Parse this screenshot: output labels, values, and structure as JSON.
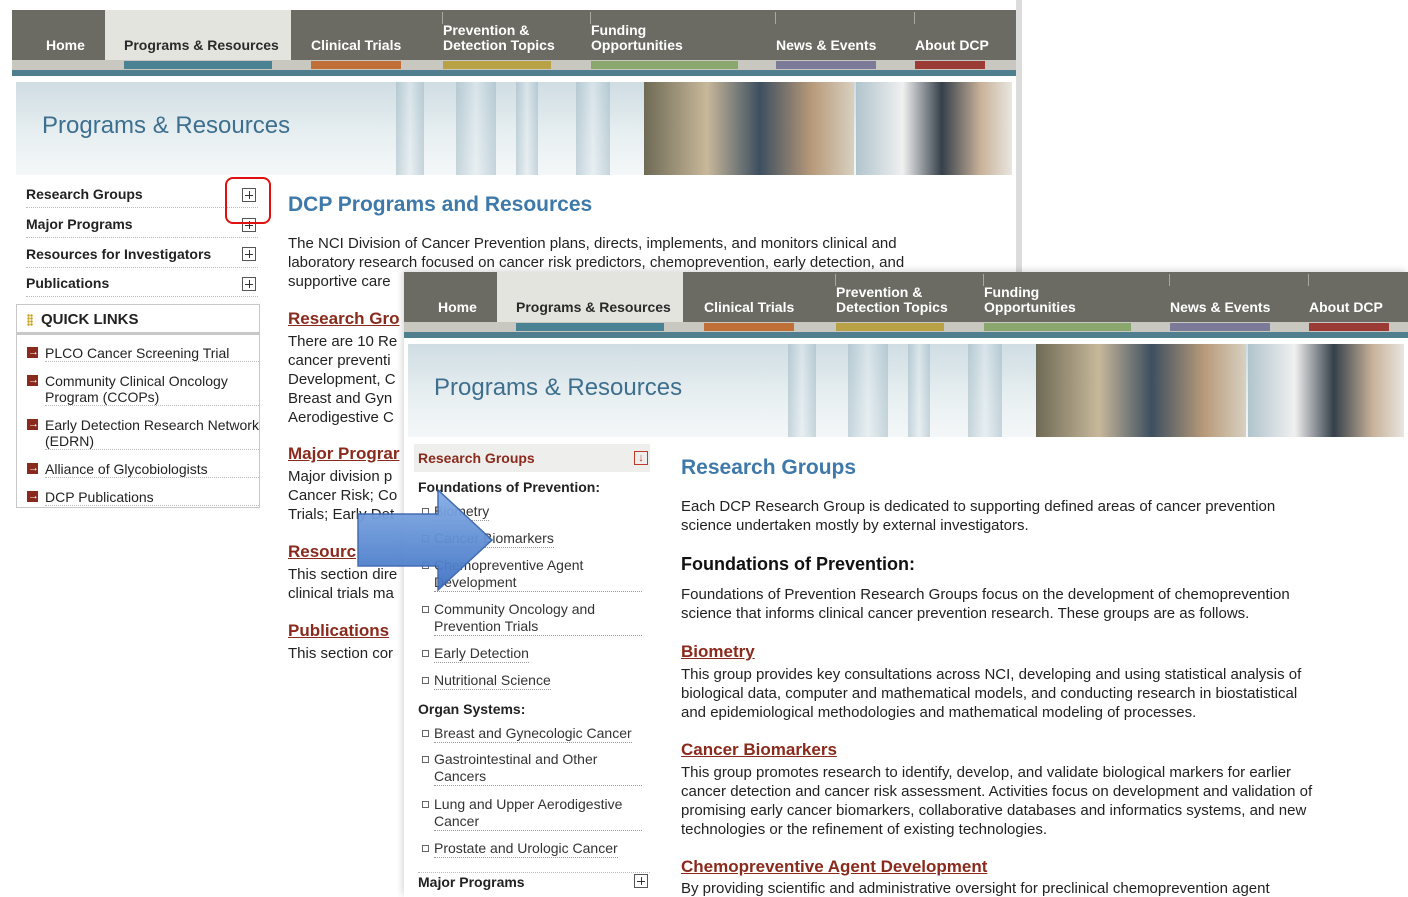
{
  "nav": {
    "items": [
      {
        "label": "Home",
        "color": "#c8c8c0"
      },
      {
        "label": "Programs & Resources",
        "color": "#4a8193"
      },
      {
        "label": "Clinical Trials",
        "color": "#c07037"
      },
      {
        "label": "Prevention & Detection Topics",
        "color": "#b9a246"
      },
      {
        "label": "Funding Opportunities",
        "color": "#8aa86e"
      },
      {
        "label": "News & Events",
        "color": "#7c7a99"
      },
      {
        "label": "About DCP",
        "color": "#9b3b35"
      }
    ],
    "active": "Programs & Resources",
    "prevention_line1": "Prevention &",
    "prevention_line2": "Detection Topics",
    "funding_line1": "Funding",
    "funding_line2": "Opportunities"
  },
  "banner": {
    "title": "Programs & Resources"
  },
  "window1": {
    "sidebar": [
      {
        "label": "Research Groups"
      },
      {
        "label": "Major Programs"
      },
      {
        "label": "Resources for Investigators"
      },
      {
        "label": "Publications"
      }
    ],
    "quick_links": {
      "title": "QUICK LINKS",
      "items": [
        {
          "label": "PLCO Cancer Screening Trial"
        },
        {
          "label": "Community Clinical Oncology Program (CCOPs)"
        },
        {
          "label": "Early Detection Research Network (EDRN)"
        },
        {
          "label": "Alliance of Glycobiologists"
        },
        {
          "label": "DCP Publications"
        }
      ]
    },
    "main": {
      "title": "DCP Programs and Resources",
      "intro_l1": "The NCI Division of Cancer Prevention plans, directs, implements, and monitors clinical and",
      "intro_l2": "laboratory research focused on cancer risk predictors, chemoprevention, early detection, and",
      "intro_l3": "supportive care",
      "rg_link": "Research Gro",
      "rg_l1": "There are 10 Re",
      "rg_l2": "cancer preventi",
      "rg_l3": "Development, C",
      "rg_l4": "Breast and Gyn",
      "rg_l5": "Aerodigestive C",
      "mp_link": "Major Prograr",
      "mp_l1": "Major division p",
      "mp_l2": "Cancer Risk; Co",
      "mp_l3": "Trials; Early Det",
      "res_link": "Resourc",
      "res_l1": "This section dire",
      "res_l2": "clinical trials ma",
      "pub_link": "Publications",
      "pub_l1": "This section cor"
    }
  },
  "window2": {
    "sidebar": {
      "research_groups": "Research Groups",
      "foundations_heading": "Foundations of Prevention:",
      "foundations_items": [
        {
          "label": "Biometry"
        },
        {
          "label": "Cancer Biomarkers"
        },
        {
          "label": "Chemopreventive Agent Development"
        },
        {
          "label": "Community Oncology and Prevention Trials"
        },
        {
          "label": "Early Detection"
        },
        {
          "label": "Nutritional Science"
        }
      ],
      "organ_heading": "Organ Systems:",
      "organ_items": [
        {
          "label": "Breast and Gynecologic Cancer"
        },
        {
          "label": "Gastrointestinal and Other Cancers"
        },
        {
          "label": "Lung and Upper Aerodigestive Cancer"
        },
        {
          "label": "Prostate and Urologic Cancer"
        }
      ],
      "major_programs": "Major Programs"
    },
    "main": {
      "title": "Research Groups",
      "intro_l1": "Each DCP Research Group is dedicated to supporting defined areas of cancer prevention",
      "intro_l2": "science undertaken mostly by external investigators.",
      "fop_heading": "Foundations of Prevention:",
      "fop_l1": "Foundations of Prevention Research Groups focus on the development of chemoprevention",
      "fop_l2": "science that informs clinical cancer prevention research. These groups are as follows.",
      "biometry_link": "Biometry",
      "biometry_l1": "This group provides key consultations across NCI, developing and using statistical analysis of",
      "biometry_l2": "biological data, computer and mathematical models, and conducting research in biostatistical",
      "biometry_l3": "and epidemiological methodologies and mathematical modeling of processes.",
      "biomarkers_link": "Cancer Biomarkers",
      "biomarkers_l1": "This group promotes research to identify, develop, and validate biological markers for earlier",
      "biomarkers_l2": "cancer detection and cancer risk assessment. Activities focus on development and validation of",
      "biomarkers_l3": "promising early cancer biomarkers, collaborative databases and informatics systems, and new",
      "biomarkers_l4": "technologies or the refinement of existing technologies.",
      "chemo_link": "Chemopreventive Agent Development",
      "chemo_l1": "By providing scientific and administrative oversight for preclinical chemoprevention agent"
    }
  }
}
